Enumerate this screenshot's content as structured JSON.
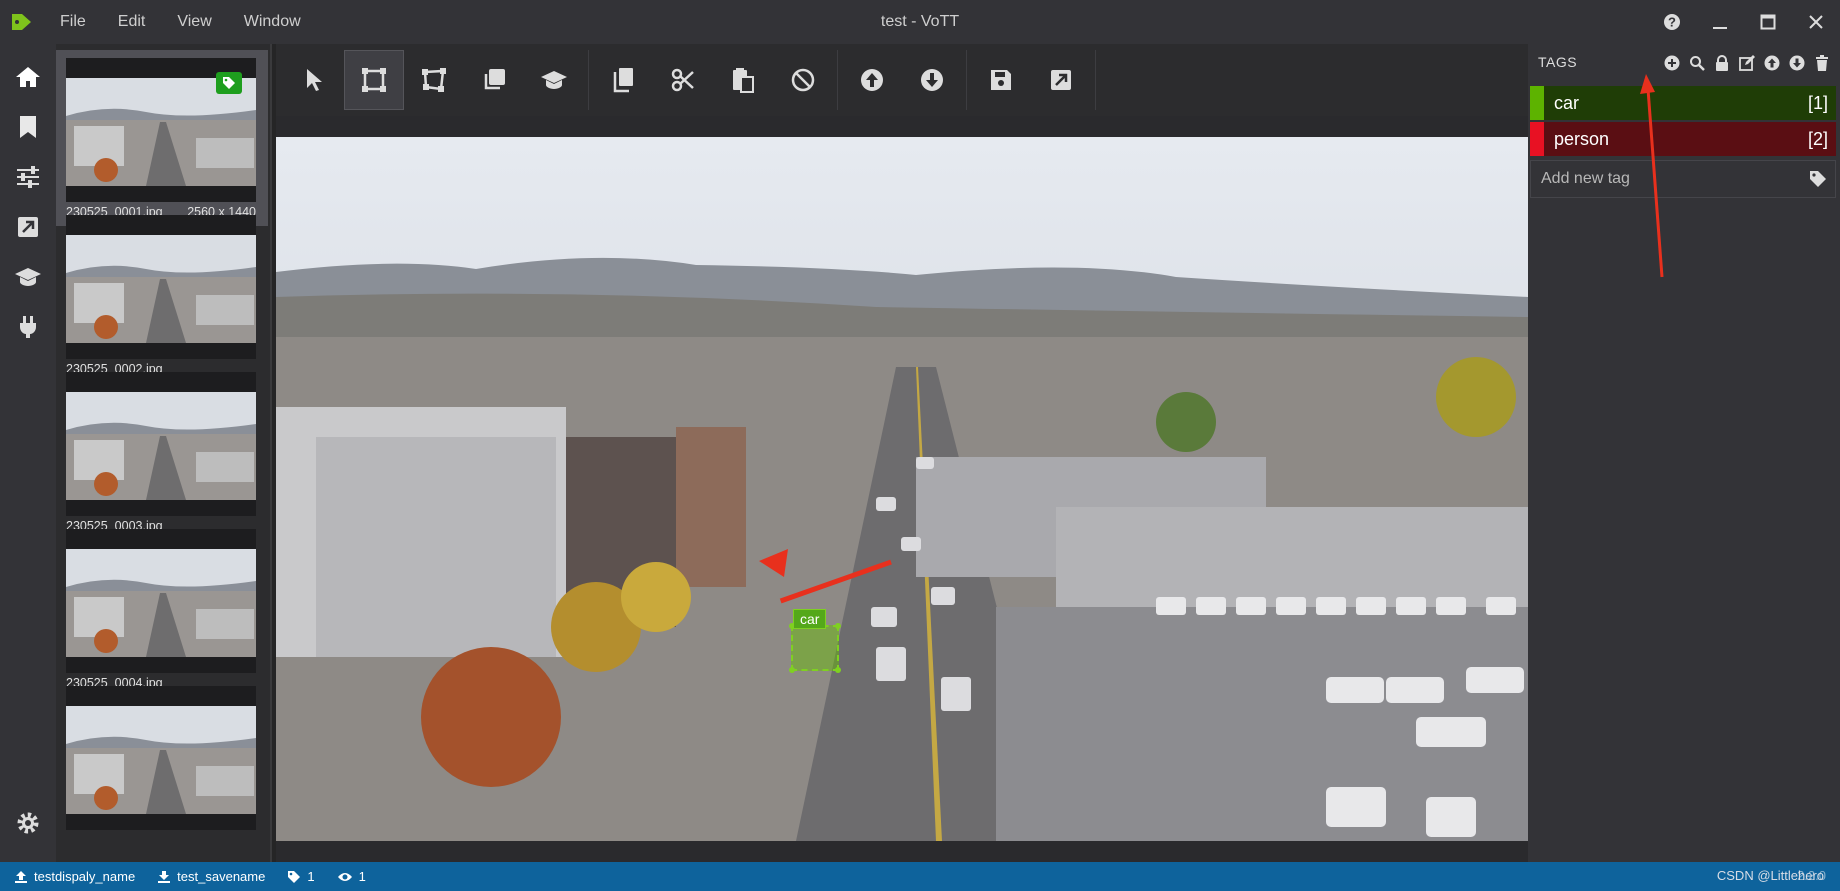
{
  "app": {
    "window_title": "test - VoTT",
    "menu": [
      "File",
      "Edit",
      "View",
      "Window"
    ],
    "controls": {
      "help": "help-icon",
      "minimize": "minimize-icon",
      "maximize": "maximize-icon",
      "close": "close-icon"
    }
  },
  "nav": {
    "items": [
      {
        "name": "home-icon"
      },
      {
        "name": "bookmark-icon"
      },
      {
        "name": "sliders-icon"
      },
      {
        "name": "export-icon"
      },
      {
        "name": "graduation-cap-icon"
      },
      {
        "name": "plug-icon"
      }
    ],
    "settings": "gear-icon"
  },
  "thumbnails": [
    {
      "filename": "230525_0001.jpg",
      "dimensions": "2560 x 1440",
      "tagged": true,
      "active": true
    },
    {
      "filename": "230525_0002.jpg",
      "dimensions": "",
      "tagged": false,
      "active": false
    },
    {
      "filename": "230525_0003.jpg",
      "dimensions": "",
      "tagged": false,
      "active": false
    },
    {
      "filename": "230525_0004.jpg",
      "dimensions": "",
      "tagged": false,
      "active": false
    },
    {
      "filename": "",
      "dimensions": "",
      "tagged": false,
      "active": false
    }
  ],
  "toolbar": {
    "groups": [
      [
        "pointer-icon",
        "rectangle-icon",
        "polygon-icon",
        "copy-rectangle-icon",
        "active-learning-icon"
      ],
      [
        "copy-icon",
        "cut-icon",
        "paste-icon",
        "clear-icon"
      ],
      [
        "previous-asset-icon",
        "next-asset-icon"
      ],
      [
        "save-icon",
        "export-icon"
      ]
    ],
    "selected": "rectangle-icon"
  },
  "canvas": {
    "region_tag": "car"
  },
  "tags": {
    "title": "TAGS",
    "actions": [
      "add-tag-icon",
      "search-tag-icon",
      "lock-tag-icon",
      "edit-tag-icon",
      "move-up-icon",
      "move-down-icon",
      "delete-tag-icon"
    ],
    "items": [
      {
        "name": "car",
        "key": "[1]",
        "color": "#5db300",
        "bg": "#1f3d06"
      },
      {
        "name": "person",
        "key": "[2]",
        "color": "#e81123",
        "bg": "#5a0e13"
      }
    ],
    "new_tag_placeholder": "Add new tag"
  },
  "status": {
    "source": "testdispaly_name",
    "target": "test_savename",
    "tagged_count": "1",
    "visited_count": "1",
    "version": "2.2.0",
    "watermark": "CSDN @Littlehero"
  },
  "colors": {
    "accent": "#0e639c",
    "region": "#7fd021"
  }
}
